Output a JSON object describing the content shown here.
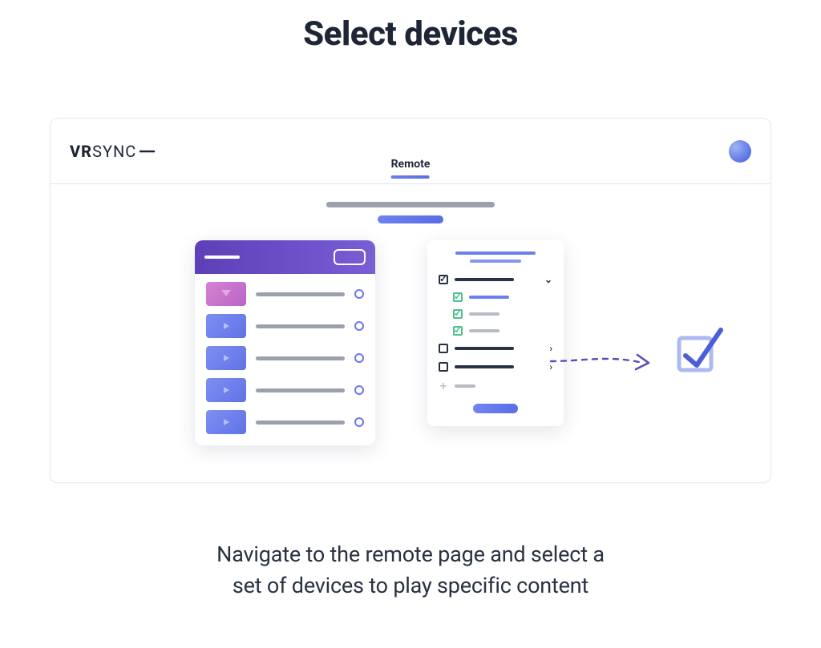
{
  "title": "Select devices",
  "logo": {
    "part1": "VR",
    "part2": "SYNC"
  },
  "tab": "Remote",
  "caption_line1": "Navigate to the remote page and select a",
  "caption_line2": "set of devices to play specific content",
  "icons": {
    "plus": "+",
    "chevron_right": "›",
    "chevron_down": "⌄"
  }
}
